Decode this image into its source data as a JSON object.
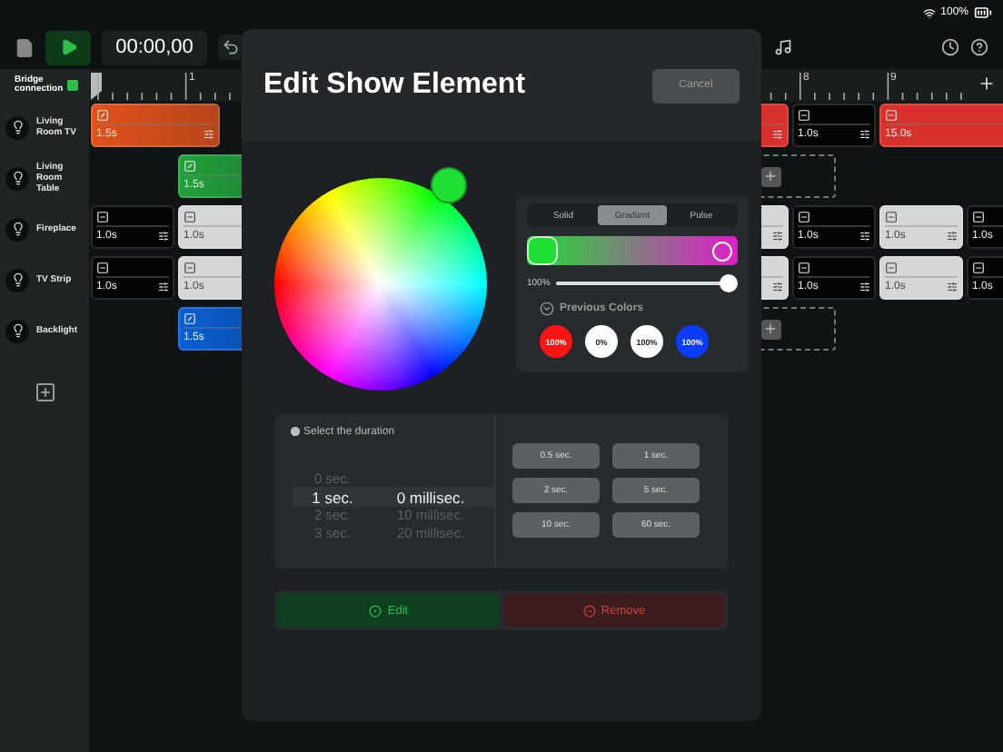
{
  "status_bar": {
    "battery": "100%"
  },
  "toolbar": {
    "time": "00:00,00"
  },
  "bridge": {
    "label": "Bridge connection",
    "connected": true
  },
  "ruler": {
    "left_labels": [
      "1"
    ],
    "right_labels": [
      "8",
      "9"
    ]
  },
  "tracks": [
    {
      "name": "Living Room TV",
      "left_clips": [
        {
          "kind": "fade",
          "color": "#e0521c",
          "duration": "1.5s",
          "menu": true,
          "wide": true
        }
      ],
      "right_clips": [
        {
          "kind": "tail",
          "color": "#d8302c"
        },
        {
          "kind": "off",
          "color": "#050505",
          "duration": "1.0s",
          "menu": true
        },
        {
          "kind": "off",
          "color": "#d8302c",
          "duration": "15.0s",
          "wide": true
        }
      ]
    },
    {
      "name": "Living Room Table",
      "left_clips": [
        {
          "kind": "gap"
        },
        {
          "kind": "fade",
          "color": "#22a23c",
          "duration": "1.5s"
        }
      ],
      "right_clips": [
        {
          "kind": "add"
        }
      ]
    },
    {
      "name": "Fireplace",
      "left_clips": [
        {
          "kind": "off",
          "color": "#050505",
          "duration": "1.0s",
          "menu": true
        },
        {
          "kind": "off",
          "color": "#d6d6d6",
          "duration": "1.0s"
        }
      ],
      "right_clips": [
        {
          "kind": "tail",
          "color": "#d6d6d6"
        },
        {
          "kind": "off",
          "color": "#050505",
          "duration": "1.0s",
          "menu": true
        },
        {
          "kind": "off",
          "color": "#d6d6d6",
          "duration": "1.0s",
          "menu": true
        },
        {
          "kind": "off",
          "color": "#050505",
          "duration": "1.0s"
        }
      ]
    },
    {
      "name": "TV Strip",
      "left_clips": [
        {
          "kind": "off",
          "color": "#050505",
          "duration": "1.0s",
          "menu": true
        },
        {
          "kind": "off",
          "color": "#d6d6d6",
          "duration": "1.0s"
        }
      ],
      "right_clips": [
        {
          "kind": "tail",
          "color": "#d6d6d6"
        },
        {
          "kind": "off",
          "color": "#050505",
          "duration": "1.0s",
          "menu": true
        },
        {
          "kind": "off",
          "color": "#d6d6d6",
          "duration": "1.0s",
          "menu": true
        },
        {
          "kind": "off",
          "color": "#050505",
          "duration": "1.0s"
        }
      ]
    },
    {
      "name": "Backlight",
      "left_clips": [
        {
          "kind": "gap"
        },
        {
          "kind": "fade",
          "color": "#0a5fd4",
          "duration": "1.5s"
        }
      ],
      "right_clips": [
        {
          "kind": "add"
        }
      ]
    }
  ],
  "dialog": {
    "title": "Edit Show Element",
    "cancel": "Cancel",
    "modes": [
      {
        "label": "Solid",
        "selected": false
      },
      {
        "label": "Gradient",
        "selected": true
      },
      {
        "label": "Pulse",
        "selected": false
      }
    ],
    "gradient_stops": [
      {
        "color": "#1ee032",
        "selected": true
      },
      {
        "color": "#e21ccc",
        "selected": false
      }
    ],
    "brightness": {
      "label": "100%",
      "level": 1.0
    },
    "previous_colors": {
      "label": "Previous Colors",
      "expanded": true,
      "swatches": [
        {
          "color": "#ff1414",
          "label": "100%"
        },
        {
          "color": "#ffffff",
          "label": "0%"
        },
        {
          "color": "#ffffff",
          "label": "100%"
        },
        {
          "color": "#0a3cff",
          "label": "100%"
        }
      ]
    },
    "duration": {
      "title": "Select the duration",
      "seconds": [
        {
          "label": "0 sec.",
          "selected": false
        },
        {
          "label": "1 sec.",
          "selected": true
        },
        {
          "label": "2 sec.",
          "selected": false
        },
        {
          "label": "3 sec.",
          "selected": false
        }
      ],
      "milliseconds": [
        {
          "label": "0 millisec.",
          "selected": true
        },
        {
          "label": "10 millisec.",
          "selected": false
        },
        {
          "label": "20 millisec.",
          "selected": false
        }
      ],
      "presets": [
        "0.5 sec.",
        "1 sec.",
        "2 sec.",
        "5 sec.",
        "10 sec.",
        "60 sec."
      ]
    },
    "actions": [
      {
        "label": "Edit",
        "kind": "primary"
      },
      {
        "label": "Remove",
        "kind": "destructive"
      }
    ]
  }
}
